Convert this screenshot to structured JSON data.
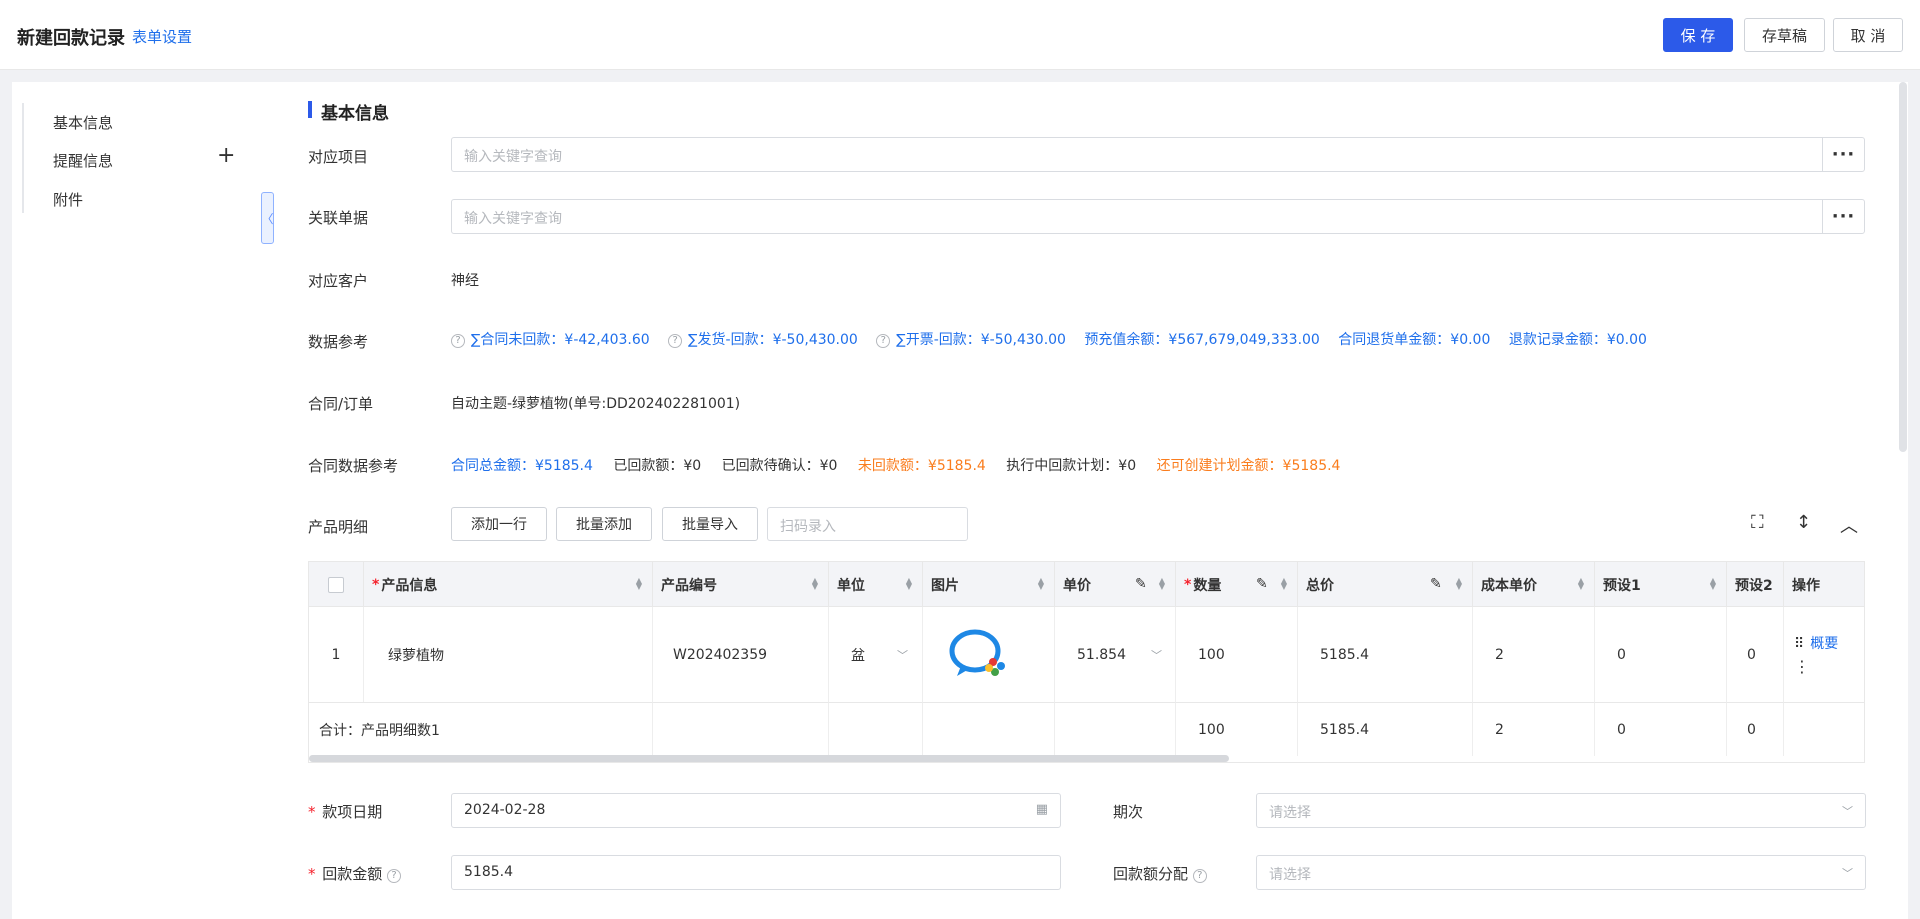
{
  "header": {
    "title": "新建回款记录",
    "form_settings": "表单设置",
    "save": "保 存",
    "draft": "存草稿",
    "cancel": "取 消"
  },
  "nav": {
    "items": [
      "基本信息",
      "提醒信息",
      "附件"
    ]
  },
  "section": {
    "title": "基本信息"
  },
  "fields": {
    "project_label": "对应项目",
    "project_placeholder": "输入关键字查询",
    "related_doc_label": "关联单据",
    "related_doc_placeholder": "输入关键字查询",
    "customer_label": "对应客户",
    "customer_value": "神经",
    "data_ref_label": "数据参考",
    "contract_label": "合同/订单",
    "contract_value": "自动主题-绿萝植物(单号:DD202402281001)",
    "contract_ref_label": "合同数据参考",
    "product_label": "产品明细"
  },
  "data_ref": [
    "∑合同未回款：¥-42,403.60",
    "∑发货-回款：¥-50,430.00",
    "∑开票-回款：¥-50,430.00",
    "预充值余额：¥567,679,049,333.00",
    "合同退货单金额：¥0.00",
    "退款记录金额：¥0.00"
  ],
  "contract_ref": {
    "total": "合同总金额：¥5185.4",
    "paid": "已回款额：¥0",
    "pending": "已回款待确认：¥0",
    "unpaid": "未回款额：¥5185.4",
    "in_plan": "执行中回款计划：¥0",
    "can_create": "还可创建计划金额：¥5185.4"
  },
  "product_toolbar": {
    "add_row": "添加一行",
    "batch_add": "批量添加",
    "batch_import": "批量导入",
    "scan_placeholder": "扫码录入"
  },
  "table": {
    "headers": [
      "产品信息",
      "产品编号",
      "单位",
      "图片",
      "单价",
      "数量",
      "总价",
      "成本单价",
      "预设1",
      "预设2",
      "操作"
    ],
    "row": {
      "index": "1",
      "product": "绿萝植物",
      "code": "W202402359",
      "unit": "盆",
      "price": "51.854",
      "qty": "100",
      "total": "5185.4",
      "cost": "2",
      "preset1": "0",
      "preset2": "0",
      "action": "概要"
    },
    "summary": {
      "label": "合计：产品明细数1",
      "qty": "100",
      "total": "5185.4",
      "cost": "2",
      "preset1": "0",
      "preset2": "0"
    }
  },
  "bottom_fields": {
    "date_label": "款项日期",
    "date_value": "2024-02-28",
    "period_label": "期次",
    "period_placeholder": "请选择",
    "amount_label": "回款金额",
    "amount_value": "5185.4",
    "allocation_label": "回款额分配",
    "allocation_placeholder": "请选择"
  },
  "icons": {
    "plus": "plus-icon",
    "collapse": "collapse-left-icon",
    "more": "more-icon",
    "fullscreen": "fullscreen-icon",
    "expand": "vertical-expand-icon",
    "collapse_up": "chevron-up-icon",
    "calendar": "calendar-icon",
    "help": "help-circle-icon"
  },
  "colors": {
    "primary": "#2c5ae9",
    "link": "#1f6feb",
    "warning": "#fa7d1e",
    "required": "#f5222d"
  }
}
